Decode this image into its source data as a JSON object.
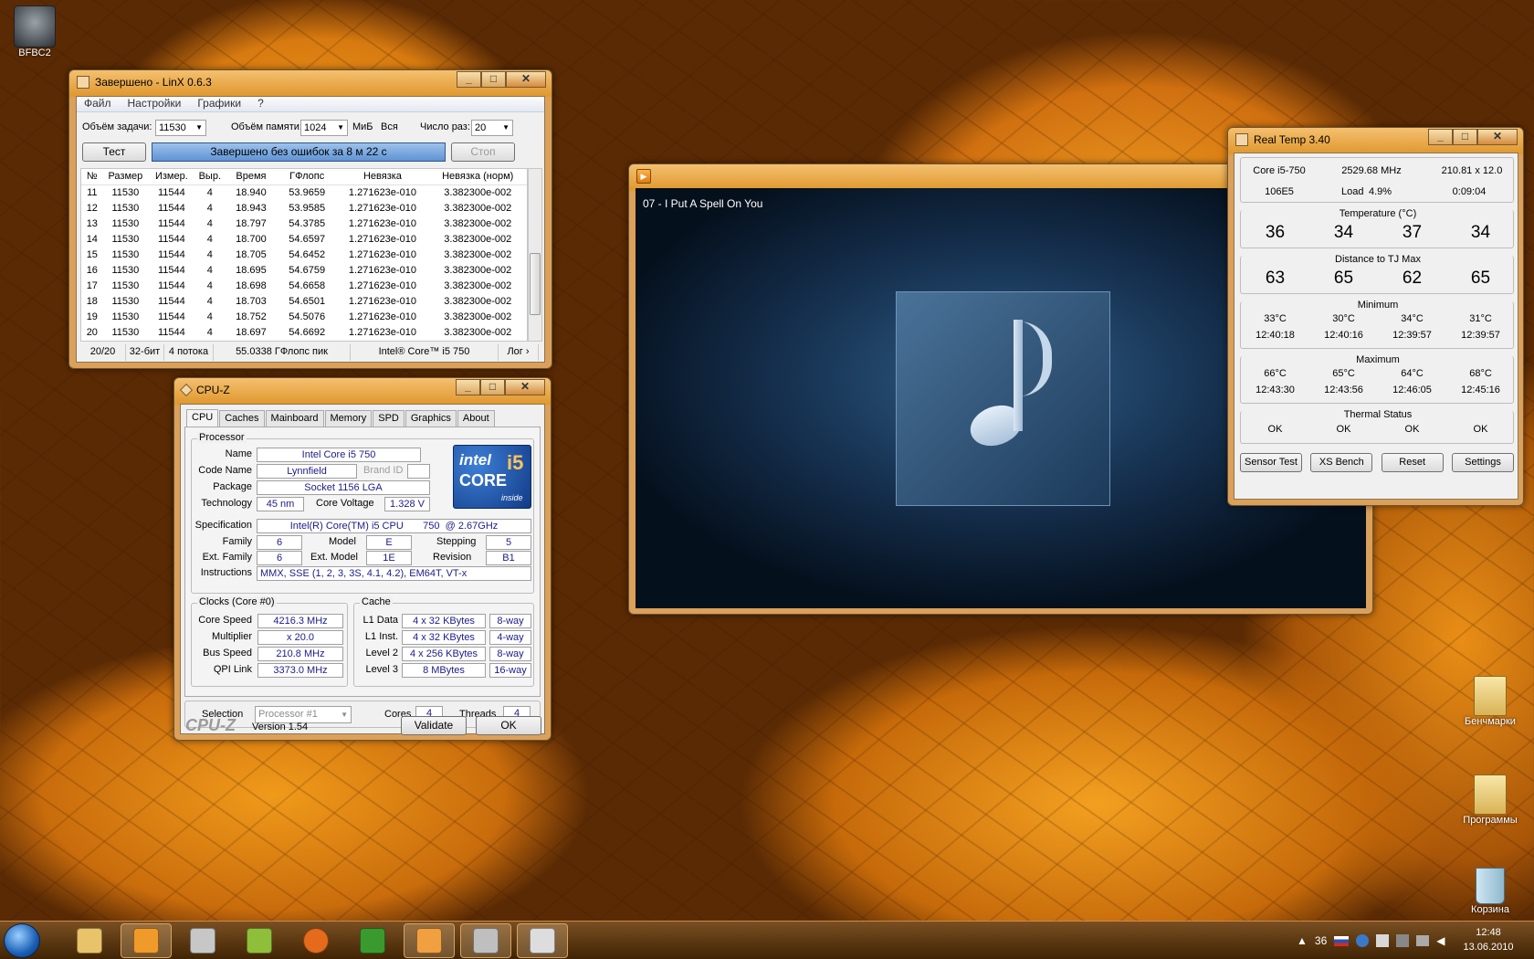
{
  "desktop": {
    "icons": [
      {
        "label": "BFBC2"
      },
      {
        "label": "Бенчмарки"
      },
      {
        "label": "Программы"
      },
      {
        "label": "Корзина"
      }
    ]
  },
  "linx": {
    "title": "Завершено - LinX 0.6.3",
    "menu": [
      "Файл",
      "Настройки",
      "Графики",
      "?"
    ],
    "task_label": "Объём задачи:",
    "task_value": "11530",
    "mem_label": "Объём памяти:",
    "mem_value": "1024",
    "mem_unit": "МиБ",
    "all_label": "Вся",
    "runs_label": "Число раз:",
    "runs_value": "20",
    "test_btn": "Тест",
    "status": "Завершено без ошибок за 8 м 22 с",
    "stop_btn": "Стоп",
    "columns": [
      "№",
      "Размер",
      "Измер.",
      "Выр.",
      "Время",
      "ГФлопс",
      "Невязка",
      "Невязка (норм)"
    ],
    "rows": [
      [
        "11",
        "11530",
        "11544",
        "4",
        "18.940",
        "53.9659",
        "1.271623e-010",
        "3.382300e-002"
      ],
      [
        "12",
        "11530",
        "11544",
        "4",
        "18.943",
        "53.9585",
        "1.271623e-010",
        "3.382300e-002"
      ],
      [
        "13",
        "11530",
        "11544",
        "4",
        "18.797",
        "54.3785",
        "1.271623e-010",
        "3.382300e-002"
      ],
      [
        "14",
        "11530",
        "11544",
        "4",
        "18.700",
        "54.6597",
        "1.271623e-010",
        "3.382300e-002"
      ],
      [
        "15",
        "11530",
        "11544",
        "4",
        "18.705",
        "54.6452",
        "1.271623e-010",
        "3.382300e-002"
      ],
      [
        "16",
        "11530",
        "11544",
        "4",
        "18.695",
        "54.6759",
        "1.271623e-010",
        "3.382300e-002"
      ],
      [
        "17",
        "11530",
        "11544",
        "4",
        "18.698",
        "54.6658",
        "1.271623e-010",
        "3.382300e-002"
      ],
      [
        "18",
        "11530",
        "11544",
        "4",
        "18.703",
        "54.6501",
        "1.271623e-010",
        "3.382300e-002"
      ],
      [
        "19",
        "11530",
        "11544",
        "4",
        "18.752",
        "54.5076",
        "1.271623e-010",
        "3.382300e-002"
      ],
      [
        "20",
        "11530",
        "11544",
        "4",
        "18.697",
        "54.6692",
        "1.271623e-010",
        "3.382300e-002"
      ]
    ],
    "statusbar": [
      "20/20",
      "32-бит",
      "4 потока",
      "55.0338 ГФлопс пик",
      "Intel® Core™ i5 750",
      "Лог ›"
    ]
  },
  "cpuz": {
    "title": "CPU-Z",
    "tabs": [
      "CPU",
      "Caches",
      "Mainboard",
      "Memory",
      "SPD",
      "Graphics",
      "About"
    ],
    "processor_title": "Processor",
    "name_l": "Name",
    "name": "Intel Core i5 750",
    "code_l": "Code Name",
    "code": "Lynnfield",
    "brand_l": "Brand ID",
    "pkg_l": "Package",
    "pkg": "Socket 1156 LGA",
    "tech_l": "Technology",
    "tech": "45 nm",
    "cv_l": "Core Voltage",
    "cv": "1.328 V",
    "spec_l": "Specification",
    "spec": "Intel(R) Core(TM) i5 CPU       750  @ 2.67GHz",
    "fam_l": "Family",
    "fam": "6",
    "model_l": "Model",
    "model": "E",
    "step_l": "Stepping",
    "step": "5",
    "efam_l": "Ext. Family",
    "efam": "6",
    "emod_l": "Ext. Model",
    "emod": "1E",
    "rev_l": "Revision",
    "rev": "B1",
    "instr_l": "Instructions",
    "instr": "MMX, SSE (1, 2, 3, 3S, 4.1, 4.2), EM64T, VT-x",
    "clocks_title": "Clocks (Core #0)",
    "cs_l": "Core Speed",
    "cs": "4216.3 MHz",
    "mul_l": "Multiplier",
    "mul": "x 20.0",
    "bus_l": "Bus Speed",
    "bus": "210.8 MHz",
    "qpi_l": "QPI Link",
    "qpi": "3373.0 MHz",
    "cache_title": "Cache",
    "l1d_l": "L1 Data",
    "l1d": "4 x 32 KBytes",
    "l1d_w": "8-way",
    "l1i_l": "L1 Inst.",
    "l1i": "4 x 32 KBytes",
    "l1i_w": "4-way",
    "l2_l": "Level 2",
    "l2": "4 x 256 KBytes",
    "l2_w": "8-way",
    "l3_l": "Level 3",
    "l3": "8 MBytes",
    "l3_w": "16-way",
    "sel_l": "Selection",
    "sel": "Processor #1",
    "cores_l": "Cores",
    "cores": "4",
    "thr_l": "Threads",
    "thr": "4",
    "logo": "CPU-Z",
    "version": "Version 1.54",
    "validate": "Validate",
    "ok": "OK",
    "intel_logo": {
      "top": "intel",
      "mid": "CORE",
      "i5": "i5",
      "bottom": "inside"
    }
  },
  "media": {
    "track": "07 - I Put A Spell On You"
  },
  "realtemp": {
    "title": "Real Temp 3.40",
    "cpu": "Core i5-750",
    "mhz": "2529.68 MHz",
    "mult": "210.81 x 12.0",
    "id": "106E5",
    "load_l": "Load",
    "load": "4.9%",
    "time": "0:09:04",
    "temp_title": "Temperature (°C)",
    "temps": [
      "36",
      "34",
      "37",
      "34"
    ],
    "dist_title": "Distance to TJ Max",
    "dist": [
      "63",
      "65",
      "62",
      "65"
    ],
    "min_title": "Minimum",
    "min": [
      "33°C",
      "30°C",
      "34°C",
      "31°C"
    ],
    "min_t": [
      "12:40:18",
      "12:40:16",
      "12:39:57",
      "12:39:57"
    ],
    "max_title": "Maximum",
    "max": [
      "66°C",
      "65°C",
      "64°C",
      "68°C"
    ],
    "max_t": [
      "12:43:30",
      "12:43:56",
      "12:46:05",
      "12:45:16"
    ],
    "th_title": "Thermal Status",
    "th": [
      "OK",
      "OK",
      "OK",
      "OK"
    ],
    "buttons": [
      "Sensor Test",
      "XS Bench",
      "Reset",
      "Settings"
    ]
  },
  "taskbar": {
    "tray_temp": "36",
    "time": "12:48",
    "date": "13.06.2010"
  }
}
